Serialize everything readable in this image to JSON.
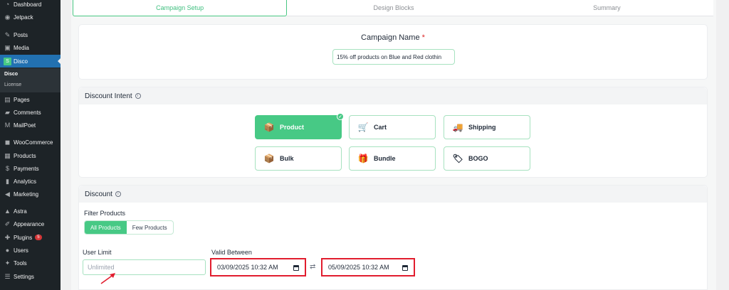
{
  "sidebar": {
    "items": [
      {
        "label": "Dashboard",
        "icon": "dashboard-icon",
        "glyph": "◔"
      },
      {
        "label": "Jetpack",
        "icon": "jetpack-icon",
        "glyph": "◉"
      },
      {
        "label": "Posts",
        "icon": "pin-icon",
        "glyph": "✎"
      },
      {
        "label": "Media",
        "icon": "media-icon",
        "glyph": "▣"
      },
      {
        "label": "Disco",
        "icon": "disco-icon",
        "glyph": "S"
      },
      {
        "label": "Pages",
        "icon": "pages-icon",
        "glyph": "▤"
      },
      {
        "label": "Comments",
        "icon": "comments-icon",
        "glyph": "▰"
      },
      {
        "label": "MailPoet",
        "icon": "mailpoet-icon",
        "glyph": "M"
      },
      {
        "label": "WooCommerce",
        "icon": "woocommerce-icon",
        "glyph": "◼"
      },
      {
        "label": "Products",
        "icon": "products-icon",
        "glyph": "▦"
      },
      {
        "label": "Payments",
        "icon": "payments-icon",
        "glyph": "$"
      },
      {
        "label": "Analytics",
        "icon": "analytics-icon",
        "glyph": "▮"
      },
      {
        "label": "Marketing",
        "icon": "marketing-icon",
        "glyph": "◀"
      },
      {
        "label": "Astra",
        "icon": "astra-icon",
        "glyph": "▲"
      },
      {
        "label": "Appearance",
        "icon": "appearance-icon",
        "glyph": "✐"
      },
      {
        "label": "Plugins",
        "icon": "plugins-icon",
        "glyph": "✚",
        "badge": "5"
      },
      {
        "label": "Users",
        "icon": "users-icon",
        "glyph": "●"
      },
      {
        "label": "Tools",
        "icon": "tools-icon",
        "glyph": "✦"
      },
      {
        "label": "Settings",
        "icon": "settings-icon",
        "glyph": "☰"
      }
    ],
    "submenu": [
      "Disco",
      "License"
    ]
  },
  "tabs": [
    "Campaign Setup",
    "Design Blocks",
    "Summary"
  ],
  "campaign": {
    "label": "Campaign Name",
    "required_mark": "*",
    "value": "15% off products on Blue and Red clothin"
  },
  "intent": {
    "title": "Discount Intent",
    "options": [
      {
        "label": "Product",
        "icon": "product-box-icon",
        "glyph": "📦",
        "selected": true
      },
      {
        "label": "Cart",
        "icon": "cart-icon",
        "glyph": "🛒"
      },
      {
        "label": "Shipping",
        "icon": "truck-icon",
        "glyph": "🚚"
      },
      {
        "label": "Bulk",
        "icon": "bulk-boxes-icon",
        "glyph": "📦"
      },
      {
        "label": "Bundle",
        "icon": "bundle-icon",
        "glyph": "🎁"
      },
      {
        "label": "BOGO",
        "icon": "bogo-icon",
        "glyph": "🏷"
      }
    ]
  },
  "discount": {
    "title": "Discount",
    "filter_label": "Filter Products",
    "filter_options": [
      "All Products",
      "Few Products"
    ],
    "user_limit_label": "User Limit",
    "user_limit_placeholder": "Unlimited",
    "valid_label": "Valid Between",
    "date_start": "03/09/2025 10:32 AM",
    "date_end": "05/09/2025 10:32 AM",
    "swap_glyph": "⇄"
  },
  "colors": {
    "accent": "#47c985",
    "highlight": "#e11d2e",
    "sidebar": "#1d2327",
    "active": "#2271b1"
  }
}
